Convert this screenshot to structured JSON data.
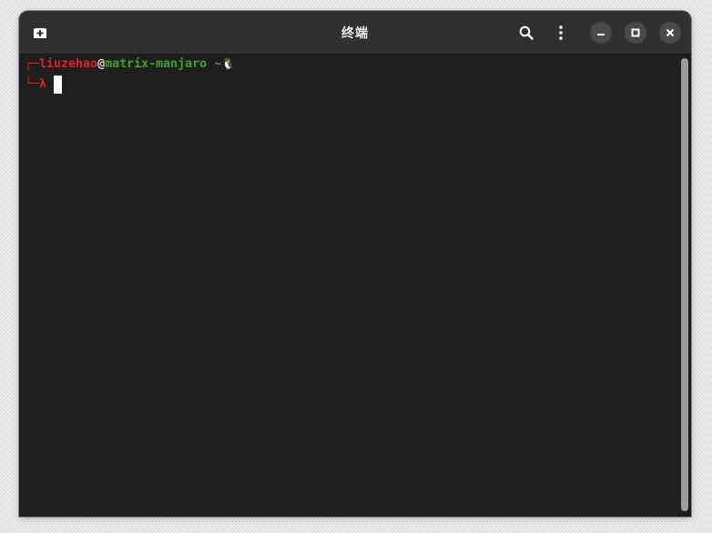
{
  "window": {
    "title": "终端"
  },
  "header": {
    "icons": {
      "new_tab": "new-tab-icon",
      "search": "search-icon",
      "menu": "kebab-menu-icon",
      "minimize": "minimize-icon",
      "maximize": "maximize-icon",
      "close": "close-icon"
    }
  },
  "terminal": {
    "prompt_line1": {
      "box_top": "┌─",
      "user": "liuzehao",
      "at": "@",
      "host": "matrix-manjaro",
      "cwd": " ~",
      "extra_glyph": "🐧"
    },
    "prompt_line2": {
      "box_bottom": "└─",
      "lambda": "λ "
    }
  },
  "colors": {
    "prompt_red": "#e02020",
    "prompt_green": "#3aa61b",
    "terminal_bg": "#1e1e1e",
    "headerbar_bg": "#303030"
  }
}
